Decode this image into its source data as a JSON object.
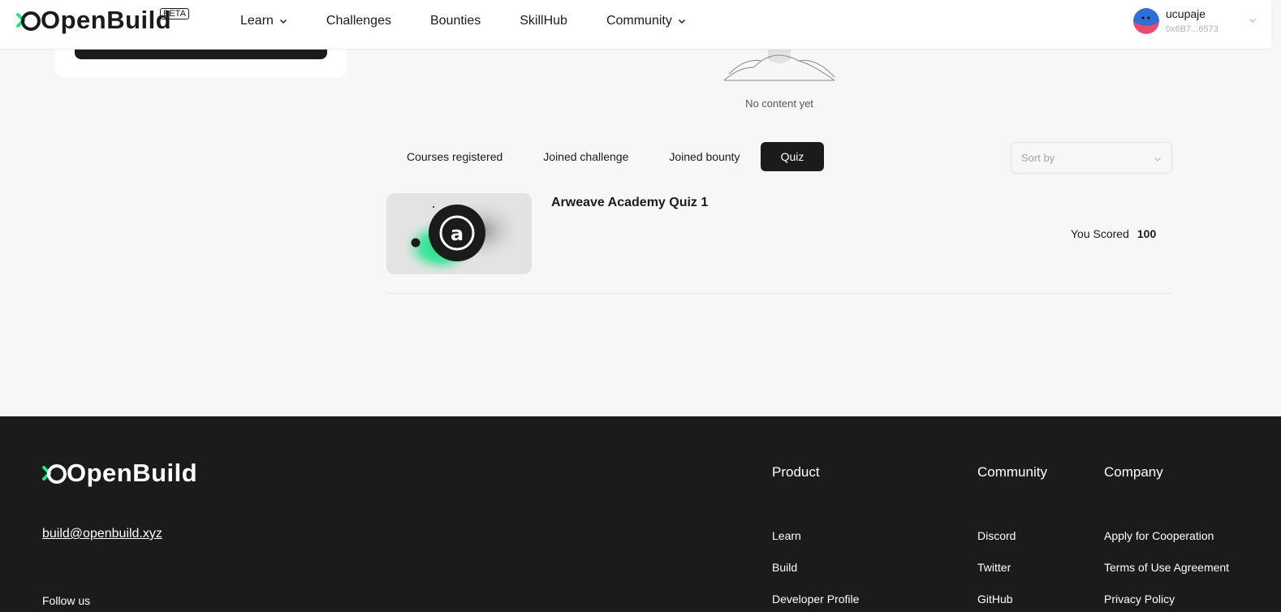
{
  "header": {
    "brand": "OpenBuild",
    "badge": "BETA",
    "nav": [
      {
        "label": "Learn",
        "dropdown": true
      },
      {
        "label": "Challenges",
        "dropdown": false
      },
      {
        "label": "Bounties",
        "dropdown": false
      },
      {
        "label": "SkillHub",
        "dropdown": false
      },
      {
        "label": "Community",
        "dropdown": true
      }
    ],
    "user": {
      "name": "ucupaje",
      "address": "0x6B7...6573"
    }
  },
  "empty_state": {
    "text": "No content yet"
  },
  "tabs": [
    {
      "label": "Courses registered",
      "active": false
    },
    {
      "label": "Joined challenge",
      "active": false
    },
    {
      "label": "Joined bounty",
      "active": false
    },
    {
      "label": "Quiz",
      "active": true
    }
  ],
  "sort": {
    "placeholder": "Sort by"
  },
  "quiz_items": [
    {
      "title": "Arweave Academy Quiz 1",
      "score_label": "You Scored",
      "score": "100",
      "thumb_letter": "a"
    }
  ],
  "footer": {
    "brand": "OpenBuild",
    "email": "build@openbuild.xyz",
    "follow": "Follow us",
    "columns": [
      {
        "title": "Product",
        "links": [
          "Learn",
          "Build",
          "Developer Profile"
        ]
      },
      {
        "title": "Community",
        "links": [
          "Discord",
          "Twitter",
          "GitHub"
        ]
      },
      {
        "title": "Company",
        "links": [
          "Apply for Cooperation",
          "Terms of Use Agreement",
          "Privacy Policy"
        ]
      }
    ]
  },
  "colors": {
    "accent": "#1ee88a",
    "dark": "#1b1b1b",
    "page_bg": "#f7f7f7"
  }
}
